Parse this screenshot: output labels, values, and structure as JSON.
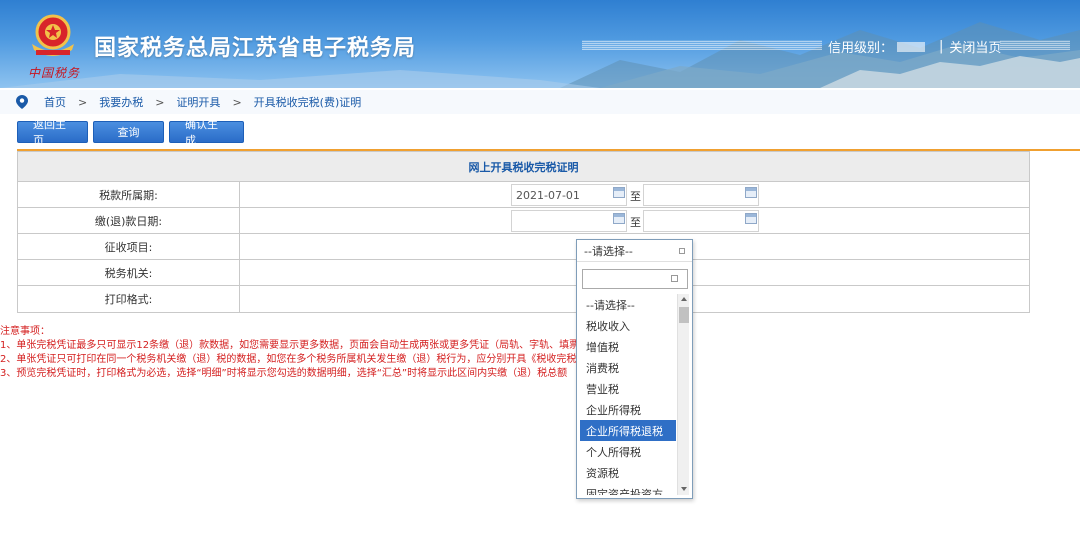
{
  "header": {
    "logo_script": "中国税务",
    "title": "国家税务总局江苏省电子税务局",
    "credit_label": "信用级别：",
    "close_label": "关闭当页",
    "separator": "|"
  },
  "breadcrumb": {
    "items": [
      "首页",
      "我要办税",
      "证明开具",
      "开具税收完税(费)证明"
    ],
    "arrow": ">"
  },
  "toolbar": {
    "home_label": "返回主页",
    "query_label": "查询",
    "generate_label": "确认生成"
  },
  "form": {
    "title": "网上开具税收完税证明",
    "rows": [
      {
        "label": "税款所属期:"
      },
      {
        "label": "缴(退)款日期:"
      },
      {
        "label": "征收项目:"
      },
      {
        "label": "税务机关:"
      },
      {
        "label": "打印格式:"
      }
    ],
    "period_start": "2021-07-01",
    "to_label": "至"
  },
  "notes": {
    "heading": "注意事项：",
    "lines": [
      "1、单张完税凭证最多只可显示12条缴（退）款数据，如您需要显示更多数据，页面会自动生成两张或更多凭证（局轨、字轨、填票",
      "2、单张凭证只可打印在同一个税务机关缴（退）税的数据，如您在多个税务所属机关发生缴（退）税行为，应分别开具《税收完税证",
      "3、预览完税凭证时，打印格式为必选，选择“明细”时将显示您勾选的数据明细，选择“汇总”时将显示此区间内实缴（退）税总额"
    ]
  },
  "dropdown": {
    "selected": "--请选择--",
    "search_value": "",
    "options": [
      "--请选择--",
      "税收收入",
      "增值税",
      "消费税",
      "营业税",
      "企业所得税",
      "企业所得税退税",
      "个人所得税",
      "资源税",
      "固定资产投资方"
    ],
    "highlighted_index": 6
  },
  "colors": {
    "header_blue": "#2f7fd1",
    "link_blue": "#1a5aa8",
    "button_blue": "#2a6cc8",
    "accent_orange": "#f0a030",
    "notes_red": "#d42020",
    "highlight_blue": "#2f6fc6"
  }
}
